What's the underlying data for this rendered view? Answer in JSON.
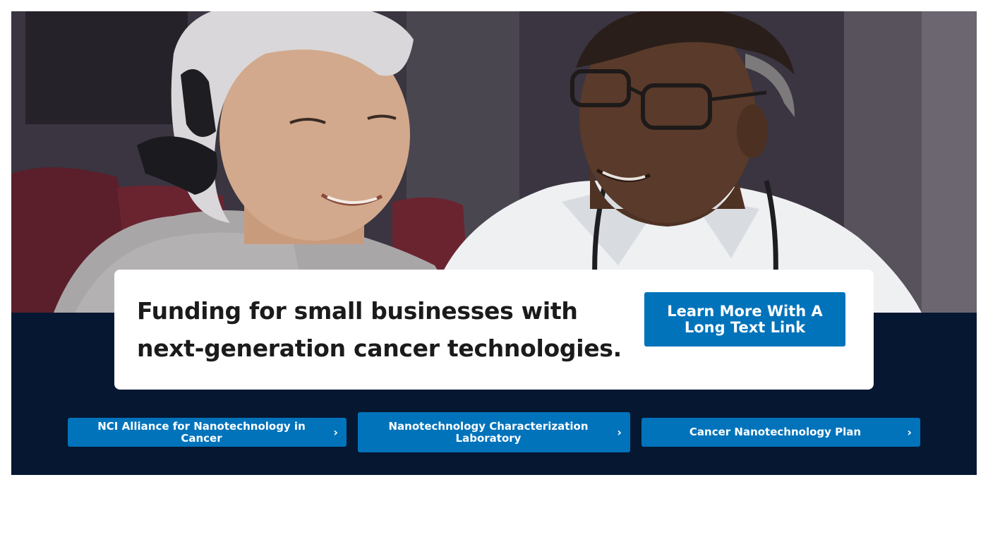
{
  "hero": {
    "image": {
      "alt": "Patient wearing a head scarf smiling with her doctor",
      "colors": {
        "background": "#3a3540",
        "scarf": "#d9d7d9",
        "skin_patient": "#d2a98c",
        "skin_doctor": "#5a3a2a",
        "coat": "#eef0f2",
        "sweater": "#a9a6a8"
      }
    },
    "feature": {
      "title": "Funding for small businesses with next-generation cancer technologies.",
      "cta_label": "Learn More With A Long Text Link"
    },
    "links": [
      {
        "label": "NCI Alliance for Nanotechnology in Cancer",
        "icon": "chevron-right-icon"
      },
      {
        "label": "Nanotechnology Characterization Laboratory",
        "icon": "chevron-right-icon"
      },
      {
        "label": "Cancer Nanotechnology Plan",
        "icon": "chevron-right-icon"
      }
    ]
  },
  "colors": {
    "band": "#061731",
    "primary": "#0073bb",
    "card": "#ffffff",
    "title_text": "#1b1b1b"
  }
}
